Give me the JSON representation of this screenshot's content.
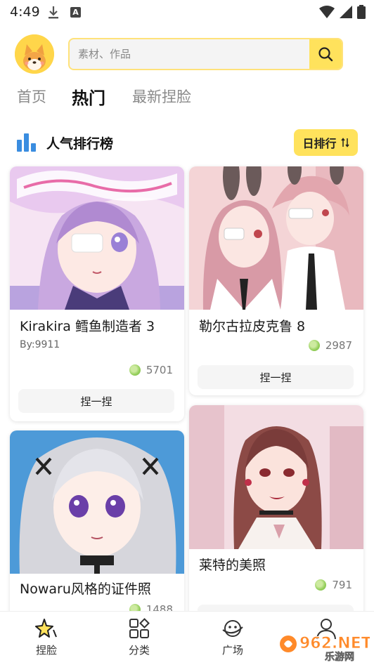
{
  "status_bar": {
    "time": "4:49"
  },
  "search": {
    "placeholder": "素材、作品"
  },
  "tabs": [
    {
      "label": "首页",
      "active": false
    },
    {
      "label": "热门",
      "active": true
    },
    {
      "label": "最新捏脸",
      "active": false
    }
  ],
  "ranking": {
    "title": "人气排行榜",
    "sort_label": "日排行"
  },
  "cards": [
    {
      "title": "Kirakira 鳕鱼制造者 3",
      "author": "By:9911",
      "likes": "5701",
      "action": "捏一捏"
    },
    {
      "title": "勒尔古拉皮克鲁 8",
      "likes": "2987",
      "action": "捏一捏"
    },
    {
      "title": "Nowaru风格的证件照",
      "likes": "1488"
    },
    {
      "title": "莱特的美照",
      "likes": "791"
    }
  ],
  "bottom_nav": [
    {
      "label": "捏脸",
      "icon": "sparkle-star-icon"
    },
    {
      "label": "分类",
      "icon": "category-grid-icon"
    },
    {
      "label": "广场",
      "icon": "planet-face-icon"
    },
    {
      "label": "我的",
      "icon": "user-icon"
    }
  ],
  "watermark": {
    "text": "962.NET",
    "subtext": "乐游网"
  },
  "colors": {
    "accent": "#ffe25c",
    "like": "#95cf5c",
    "rank_icon": "#3a8de0"
  }
}
